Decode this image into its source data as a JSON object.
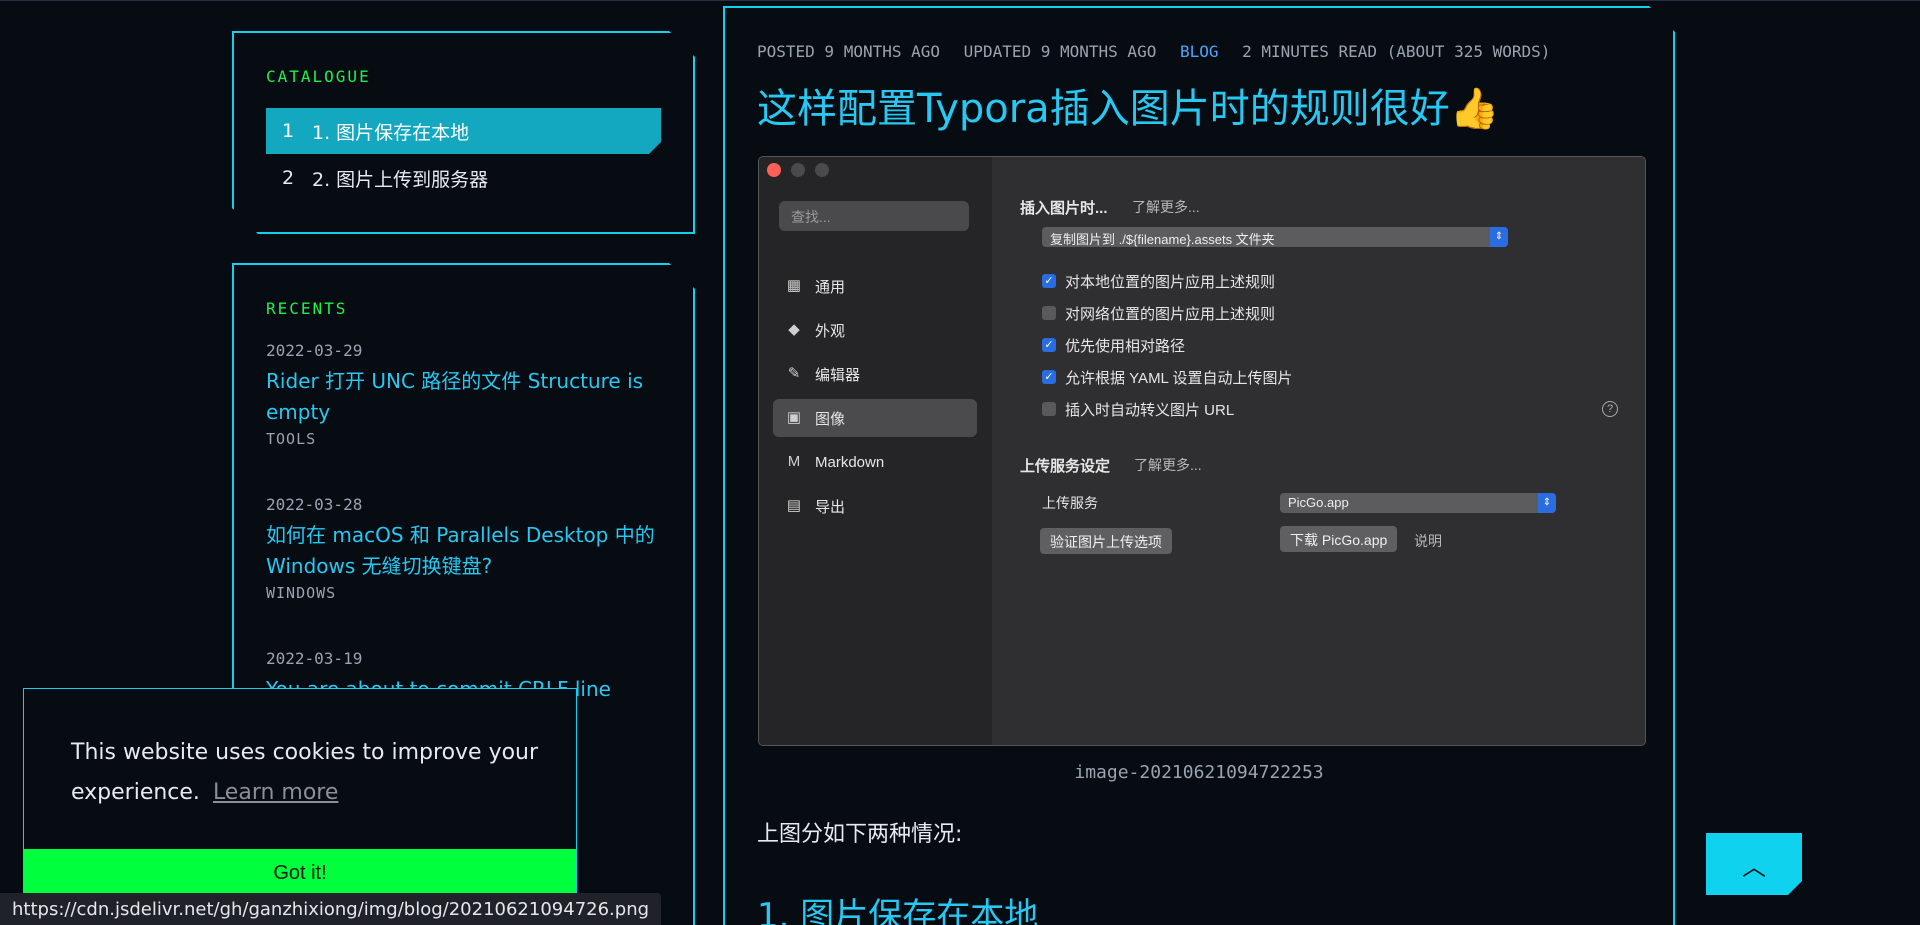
{
  "catalogue": {
    "title": "CATALOGUE",
    "items": [
      {
        "num": "1",
        "label": "1. 图片保存在本地",
        "active": true
      },
      {
        "num": "2",
        "label": "2. 图片上传到服务器",
        "active": false
      }
    ]
  },
  "recents": {
    "title": "RECENTS",
    "items": [
      {
        "date": "2022-03-29",
        "title": "Rider 打开 UNC 路径的文件 Structure is empty",
        "tag": "TOOLS"
      },
      {
        "date": "2022-03-28",
        "title": "如何在 macOS 和 Parallels Desktop 中的 Windows 无缝切换键盘?",
        "tag": "WINDOWS"
      },
      {
        "date": "2022-03-19",
        "title": "You are about to commit CRLF line",
        "tag": ""
      }
    ]
  },
  "post": {
    "meta": {
      "posted": "POSTED 9 MONTHS AGO",
      "updated": "UPDATED 9 MONTHS AGO",
      "category": "BLOG",
      "read": "2 MINUTES READ (ABOUT 325 WORDS)"
    },
    "title": "这样配置Typora插入图片时的规则很好👍",
    "caption": "image-20210621094722253",
    "paragraph": "上图分如下两种情况:",
    "heading": "1. 图片保存在本地"
  },
  "screenshot": {
    "search_placeholder": "查找...",
    "nav": [
      {
        "icon": "grid-icon",
        "glyph": "▦",
        "label": "通用"
      },
      {
        "icon": "paint-bucket-icon",
        "glyph": "◆",
        "label": "外观"
      },
      {
        "icon": "pencil-icon",
        "glyph": "✎",
        "label": "编辑器"
      },
      {
        "icon": "image-icon",
        "glyph": "▣",
        "label": "图像"
      },
      {
        "icon": "markdown-icon",
        "glyph": "M",
        "label": "Markdown"
      },
      {
        "icon": "printer-icon",
        "glyph": "▤",
        "label": "导出"
      }
    ],
    "insert_label": "插入图片时...",
    "learn_more": "了解更多...",
    "insert_option": "复制图片到 ./${filename}.assets 文件夹",
    "checks": [
      {
        "label": "对本地位置的图片应用上述规则",
        "checked": true
      },
      {
        "label": "对网络位置的图片应用上述规则",
        "checked": false
      },
      {
        "label": "优先使用相对路径",
        "checked": true
      },
      {
        "label": "允许根据 YAML 设置自动上传图片",
        "checked": true
      },
      {
        "label": "插入时自动转义图片 URL",
        "checked": false
      }
    ],
    "upload_section": "上传服务设定",
    "upload_learn_more": "了解更多...",
    "upload_service_label": "上传服务",
    "upload_service_value": "PicGo.app",
    "verify_button": "验证图片上传选项",
    "download_button": "下载 PicGo.app",
    "explain": "说明"
  },
  "cookie": {
    "message": "This website uses cookies to improve your experience.",
    "learn_more": "Learn more",
    "accept": "Got it!"
  },
  "status_url": "https://cdn.jsdelivr.net/gh/ganzhixiong/img/blog/20210621094726.png",
  "colors": {
    "accent": "#0fd3ee",
    "link": "#27c8f2",
    "green": "#1df04f",
    "cookie_button": "#00ff3c"
  }
}
